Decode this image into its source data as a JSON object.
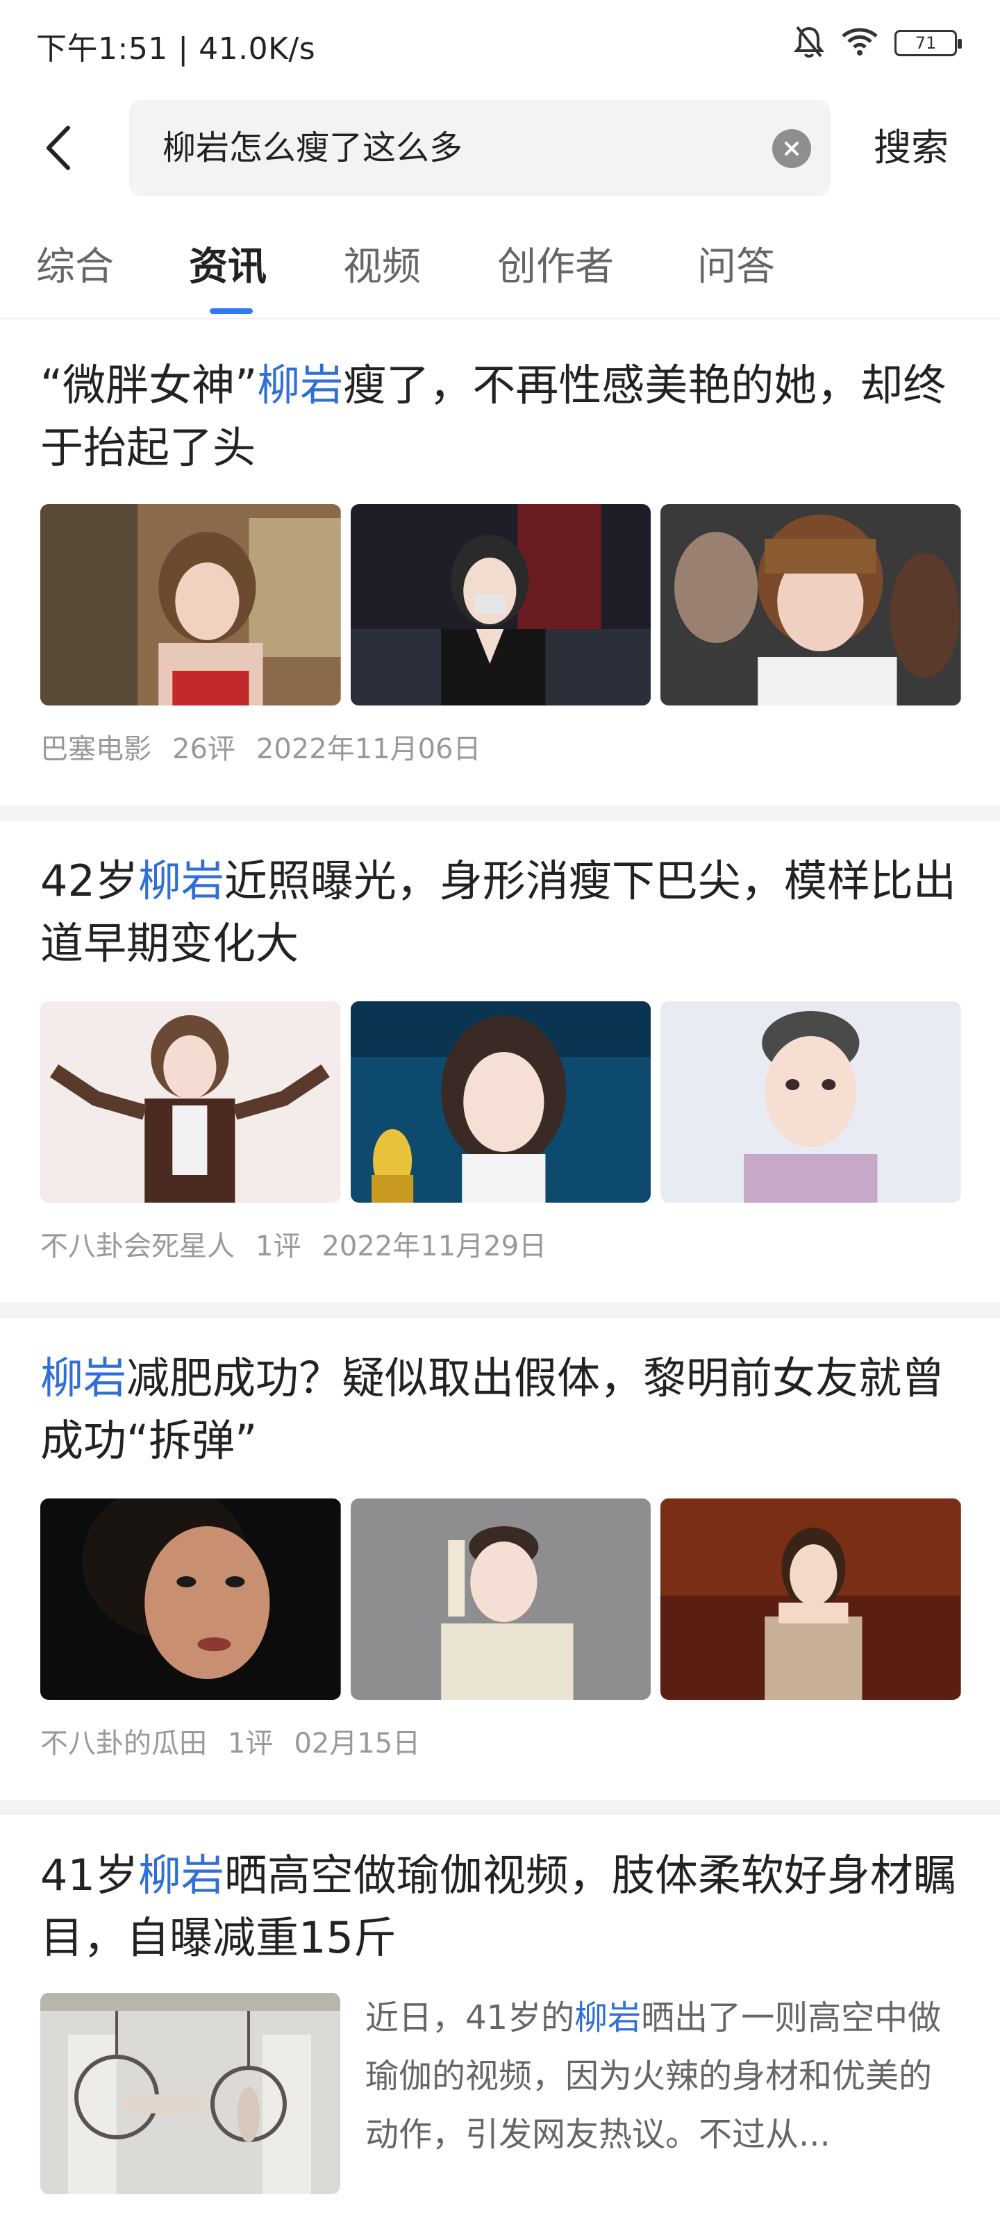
{
  "status_bar": {
    "time_speed": "下午1:51 | 41.0K/s",
    "battery": "71"
  },
  "search": {
    "query": "柳岩怎么瘦了这么多",
    "button_label": "搜索"
  },
  "tabs": [
    {
      "label": "综合"
    },
    {
      "label": "资讯"
    },
    {
      "label": "视频"
    },
    {
      "label": "创作者"
    },
    {
      "label": "问答"
    }
  ],
  "articles": [
    {
      "title_pre": "“微胖女神”",
      "title_hl": "柳岩",
      "title_post": "瘦了，不再性感美艳的她，却终于抬起了头",
      "source": "巴塞电影",
      "comments": "26评",
      "date": "2022年11月06日"
    },
    {
      "title_pre": "42岁",
      "title_hl": "柳岩",
      "title_post": "近照曝光，身形消瘦下巴尖，模样比出道早期变化大",
      "source": "不八卦会死星人",
      "comments": "1评",
      "date": "2022年11月29日"
    },
    {
      "title_pre": "",
      "title_hl": "柳岩",
      "title_post": "减肥成功？疑似取出假体，黎明前女友就曾成功“拆弹”",
      "source": "不八卦的瓜田",
      "comments": "1评",
      "date": "02月15日"
    },
    {
      "title_pre": "41岁",
      "title_hl": "柳岩",
      "title_post": "晒高空做瑜伽视频，肢体柔软好身材瞩目，自曝减重15斤",
      "summary_pre": "近日，41岁的",
      "summary_hl": "柳岩",
      "summary_post": "晒出了一则高空中做瑜伽的视频，因为火辣的身材和优美的动作，引发网友热议。不过从..."
    }
  ],
  "colors": {
    "accent": "#2f7bf5",
    "highlight": "#2f6fd6",
    "meta": "#999999"
  }
}
